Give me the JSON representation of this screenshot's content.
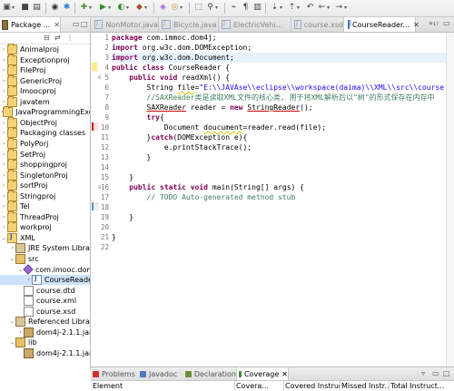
{
  "toolbar": {
    "icons": [
      "new-icon",
      "save-icon",
      "print-icon",
      "debug-icon",
      "run-icon",
      "search-icon",
      "next-annotation-icon",
      "prev-annotation-icon",
      "back-icon",
      "forward-icon"
    ]
  },
  "package_explorer": {
    "tab_label": "Package ...",
    "tab_close": "✕",
    "items": [
      {
        "label": "Animalproj",
        "type": "proj",
        "indent": 0,
        "arrow": "›"
      },
      {
        "label": "Exceptionproj",
        "type": "proj",
        "indent": 0,
        "arrow": "›"
      },
      {
        "label": "FileProj",
        "type": "proj",
        "indent": 0,
        "arrow": "›"
      },
      {
        "label": "GenericProj",
        "type": "proj",
        "indent": 0,
        "arrow": "›"
      },
      {
        "label": "Imoocproj",
        "type": "proj",
        "indent": 0,
        "arrow": "›"
      },
      {
        "label": "javatem",
        "type": "proj",
        "indent": 0,
        "arrow": "›"
      },
      {
        "label": "JavaProgrammingExe",
        "type": "proj",
        "indent": 0,
        "arrow": "›"
      },
      {
        "label": "ObjectProj",
        "type": "proj",
        "indent": 0,
        "arrow": "›"
      },
      {
        "label": "Packaging classes",
        "type": "proj",
        "indent": 0,
        "arrow": "›"
      },
      {
        "label": "PolyPorj",
        "type": "proj",
        "indent": 0,
        "arrow": "›"
      },
      {
        "label": "SetProj",
        "type": "proj",
        "indent": 0,
        "arrow": "›"
      },
      {
        "label": "shoppingproj",
        "type": "proj",
        "indent": 0,
        "arrow": "›"
      },
      {
        "label": "SingletonProj",
        "type": "proj",
        "indent": 0,
        "arrow": "›"
      },
      {
        "label": "sortProj",
        "type": "proj",
        "indent": 0,
        "arrow": "›"
      },
      {
        "label": "Stringproj",
        "type": "proj",
        "indent": 0,
        "arrow": "›"
      },
      {
        "label": "Tel",
        "type": "proj",
        "indent": 0,
        "arrow": "›"
      },
      {
        "label": "ThreadProj",
        "type": "proj",
        "indent": 0,
        "arrow": "›"
      },
      {
        "label": "workproj",
        "type": "proj",
        "indent": 0,
        "arrow": "›"
      },
      {
        "label": "XML",
        "type": "jproj",
        "indent": 0,
        "arrow": "⌄"
      },
      {
        "label": "JRE System Library",
        "type": "lib",
        "indent": 1,
        "arrow": "›"
      },
      {
        "label": "src",
        "type": "src",
        "indent": 1,
        "arrow": "⌄"
      },
      {
        "label": "com.imooc.dom",
        "type": "pkgi",
        "indent": 2,
        "arrow": "⌄"
      },
      {
        "label": "CourseReade",
        "type": "java",
        "indent": 3,
        "arrow": "›",
        "selected": true
      },
      {
        "label": "course.dtd",
        "type": "file",
        "indent": 2,
        "arrow": ""
      },
      {
        "label": "course.xml",
        "type": "file",
        "indent": 2,
        "arrow": ""
      },
      {
        "label": "course.xsd",
        "type": "file",
        "indent": 2,
        "arrow": ""
      },
      {
        "label": "Referenced Librari",
        "type": "lib",
        "indent": 1,
        "arrow": "⌄"
      },
      {
        "label": "dom4j-2.1.1.jar",
        "type": "jar",
        "indent": 2,
        "arrow": "›"
      },
      {
        "label": "lib",
        "type": "src",
        "indent": 1,
        "arrow": "⌄"
      },
      {
        "label": "dom4j-2.1.1.jar",
        "type": "jar",
        "indent": 2,
        "arrow": ""
      }
    ]
  },
  "editor": {
    "tabs": [
      {
        "label": "NonMotor.java",
        "active": false
      },
      {
        "label": "Bicycle.java",
        "active": false
      },
      {
        "label": "ElectricVehi...",
        "active": false
      },
      {
        "label": "course.xsd",
        "active": false
      },
      {
        "label": "CourseReader...",
        "active": true
      }
    ],
    "tab_close": "✕",
    "tab_overflow": "»₁₇",
    "line_numbers": [
      "1",
      "2",
      "3",
      "4",
      "5",
      "6",
      "7",
      "8",
      "9",
      "10",
      "11",
      "12",
      "13",
      "14",
      "15",
      "16",
      "17",
      "18",
      "19",
      "20",
      "21",
      "22"
    ],
    "code": [
      "package com.immoc.dom4j;",
      "import org.w3c.dom.DOMException;",
      "import org.w3c.dom.Document;",
      "public class CourseReader {",
      "    public void readXml() {",
      "        String file=\"E:\\\\JAVAse\\\\eclipse\\\\workspace(daima)\\\\XML\\\\src\\\\course.xml\";",
      "        //SAXReader类是读取XML文件的核心类, 用于将XML解析后以\"树\"的形式保存在内存中",
      "        SAXReader reader = new StringReader();",
      "        try{",
      "            Document doucument=reader.read(file);",
      "        }catch(DOMException e){",
      "            e.printStackTrace();",
      "        }",
      "",
      "    }",
      "    public static void main(String[] args) {",
      "        // TODO Auto-generated method stub",
      "",
      "    }",
      "",
      "}",
      ""
    ]
  },
  "bottom_panel": {
    "tabs": [
      {
        "label": "Problems",
        "active": false,
        "color": "#c9302c"
      },
      {
        "label": "Javadoc",
        "active": false,
        "color": "#4b78c0"
      },
      {
        "label": "Declaration",
        "active": false,
        "color": "#6b8f3a"
      },
      {
        "label": "Coverage",
        "active": true,
        "color": "#3f8b3f"
      }
    ],
    "close": "✕",
    "columns": [
      "Element",
      "Covera...",
      "Covered Instruc...",
      "Missed Instr...",
      "Total Instruct..."
    ]
  }
}
